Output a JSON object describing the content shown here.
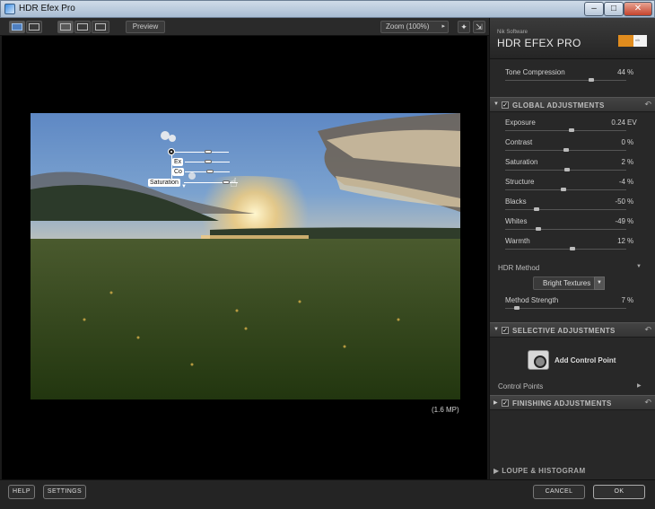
{
  "window": {
    "title": "HDR Efex Pro",
    "minimize_glyph": "–",
    "maximize_glyph": "□",
    "close_glyph": "✕"
  },
  "toolbar": {
    "preview_label": "Preview",
    "zoom_label": "Zoom (100%)",
    "zoom_arrow": "▸"
  },
  "canvas": {
    "image_size_label": "(1.6 MP)",
    "control_point": {
      "tags": [
        "Ex",
        "Co",
        "Saturation"
      ],
      "slider_levels": [
        0.62,
        0.52,
        0.56,
        0.78
      ]
    }
  },
  "panel": {
    "brand_sub": "Nik Software",
    "brand_title": "HDR EFEX PRO",
    "tone_compression": {
      "label": "Tone Compression",
      "value": "44",
      "unit": "%",
      "level": 0.72
    },
    "global": {
      "title": "GLOBAL ADJUSTMENTS",
      "sliders": [
        {
          "label": "Exposure",
          "value": "0.24",
          "unit": "EV",
          "level": 0.55
        },
        {
          "label": "Contrast",
          "value": "0",
          "unit": "%",
          "level": 0.5
        },
        {
          "label": "Saturation",
          "value": "2",
          "unit": "%",
          "level": 0.51
        },
        {
          "label": "Structure",
          "value": "-4",
          "unit": "%",
          "level": 0.48
        },
        {
          "label": "Blacks",
          "value": "-50",
          "unit": "%",
          "level": 0.25
        },
        {
          "label": "Whites",
          "value": "-49",
          "unit": "%",
          "level": 0.26
        },
        {
          "label": "Warmth",
          "value": "12",
          "unit": "%",
          "level": 0.56
        }
      ],
      "hdr_method_label": "HDR Method",
      "hdr_method_value": "Bright Textures",
      "method_strength": {
        "label": "Method Strength",
        "value": "7",
        "unit": "%",
        "level": 0.08
      }
    },
    "selective": {
      "title": "SELECTIVE ADJUSTMENTS",
      "add_control_point": "Add Control Point",
      "control_points_label": "Control Points"
    },
    "finishing": {
      "title": "FINISHING ADJUSTMENTS"
    },
    "loupe": {
      "title": "LOUPE & HISTOGRAM"
    }
  },
  "bottom": {
    "help": "HELP",
    "settings": "SETTINGS",
    "cancel": "CANCEL",
    "ok": "OK"
  },
  "colors": {
    "panel_bg": "#282828",
    "canvas_bg": "#000000",
    "brand_accent": "#e08c1e"
  }
}
